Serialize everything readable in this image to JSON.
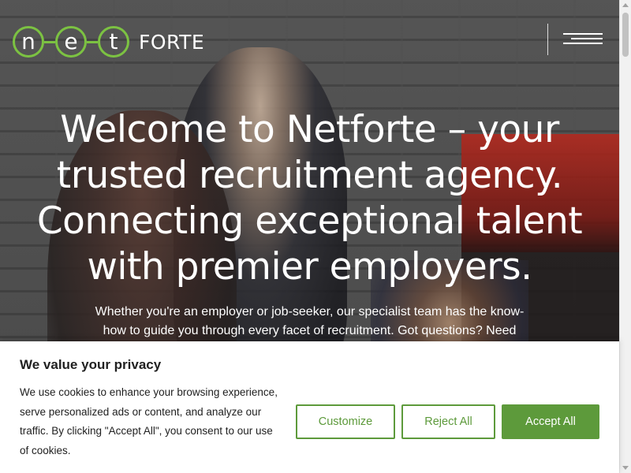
{
  "header": {
    "logo": {
      "letters": [
        "n",
        "e",
        "t"
      ],
      "wordmark": "FORTE",
      "accent_color": "#7cc242"
    },
    "menu_icon": "hamburger-menu-icon"
  },
  "hero": {
    "heading": "Welcome to Netforte – your trusted recruitment agency. Connecting exceptional talent with premier employers.",
    "subtext": "Whether you're an employer or job-seeker, our specialist team has the know-how to guide you through every facet of recruitment. Got questions? Need"
  },
  "cookie_banner": {
    "title": "We value your privacy",
    "text": "We use cookies to enhance your browsing experience, serve personalized ads or content, and analyze our traffic. By clicking \"Accept All\", you consent to our use of cookies.",
    "buttons": {
      "customize": "Customize",
      "reject": "Reject All",
      "accept": "Accept All"
    },
    "accent_color": "#5d9a3b"
  }
}
